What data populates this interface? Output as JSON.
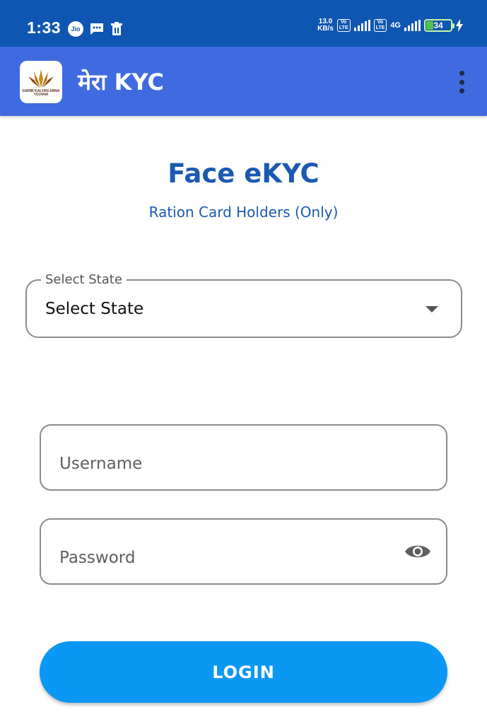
{
  "status_bar": {
    "time": "1:33",
    "carrier_icon": "Jio",
    "speed_value": "13.0",
    "speed_unit": "KB/s",
    "volte_1": "Vo\nLTE",
    "volte_2": "Vo\nLTE",
    "network": "4G",
    "battery": "34"
  },
  "app_bar": {
    "title": "मेरा KYC",
    "logo_text": "GARIB KALYAN ANNA YOJANA",
    "menu_icon": "more-vert-icon"
  },
  "main": {
    "title": "Face eKYC",
    "subtitle": "Ration Card Holders (Only)",
    "state_select": {
      "legend": "Select State",
      "selected": "Select State"
    },
    "username": {
      "placeholder": "Username",
      "value": ""
    },
    "password": {
      "placeholder": "Password",
      "value": ""
    },
    "login_label": "LOGIN"
  },
  "colors": {
    "status_bar": "#0f56b3",
    "app_bar": "#3f6ae0",
    "title": "#1c59b0",
    "login_button": "#0b98f5"
  }
}
